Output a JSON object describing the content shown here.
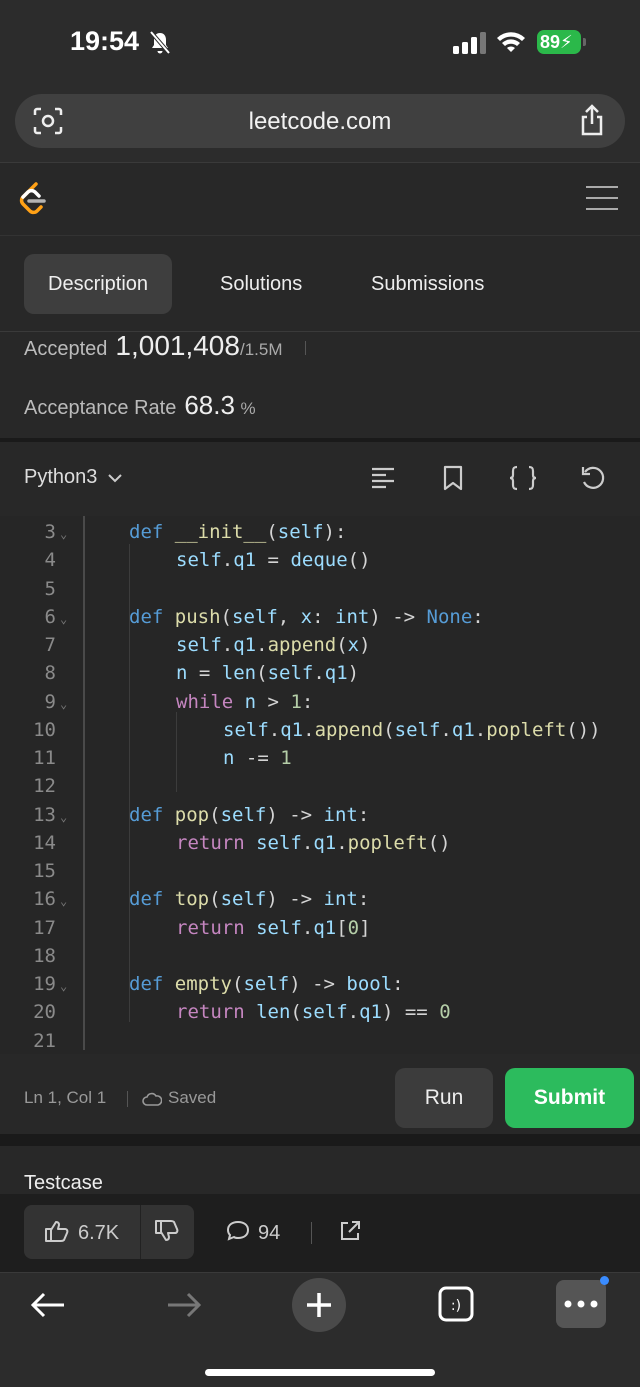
{
  "status_bar": {
    "time": "19:54",
    "battery": "89"
  },
  "browser": {
    "url": "leetcode.com"
  },
  "tabs": [
    {
      "label": "Description",
      "active": true
    },
    {
      "label": "Solutions",
      "active": false
    },
    {
      "label": "Submissions",
      "active": false
    }
  ],
  "stats": {
    "accepted_label": "Accepted",
    "accepted_value": "1,001,408",
    "accepted_total": "/1.5M",
    "rate_label": "Acceptance Rate",
    "rate_value": "68.3",
    "rate_unit": "%"
  },
  "editor": {
    "language": "Python3",
    "toolbar_icons": [
      "format-icon",
      "bookmark-icon",
      "braces-icon",
      "reset-icon"
    ]
  },
  "code_lines": [
    {
      "num": "3",
      "fold": true
    },
    {
      "num": "4",
      "fold": false
    },
    {
      "num": "5",
      "fold": false
    },
    {
      "num": "6",
      "fold": true
    },
    {
      "num": "7",
      "fold": false
    },
    {
      "num": "8",
      "fold": false
    },
    {
      "num": "9",
      "fold": true
    },
    {
      "num": "10",
      "fold": false
    },
    {
      "num": "11",
      "fold": false
    },
    {
      "num": "12",
      "fold": false
    },
    {
      "num": "13",
      "fold": true
    },
    {
      "num": "14",
      "fold": false
    },
    {
      "num": "15",
      "fold": false
    },
    {
      "num": "16",
      "fold": true
    },
    {
      "num": "17",
      "fold": false
    },
    {
      "num": "18",
      "fold": false
    },
    {
      "num": "19",
      "fold": true
    },
    {
      "num": "20",
      "fold": false
    },
    {
      "num": "21",
      "fold": false
    }
  ],
  "code_text": [
    "def __init__(self):",
    "self.q1 = deque()",
    "",
    "def push(self, x: int) -> None:",
    "self.q1.append(x)",
    "n = len(self.q1)",
    "while n > 1:",
    "self.q1.append(self.q1.popleft())",
    "n -= 1",
    "",
    "def pop(self) -> int:",
    "return self.q1.popleft()",
    "",
    "def top(self) -> int:",
    "return self.q1[0]",
    "",
    "def empty(self) -> bool:",
    "return len(self.q1) == 0",
    ""
  ],
  "action_bar": {
    "position": "Ln 1, Col 1",
    "saved": "Saved",
    "run": "Run",
    "submit": "Submit"
  },
  "testcase": {
    "label": "Testcase"
  },
  "engagement": {
    "likes": "6.7K",
    "comments": "94"
  },
  "colors": {
    "submit": "#2cbb5d",
    "accent_blue": "#3a8cff"
  }
}
